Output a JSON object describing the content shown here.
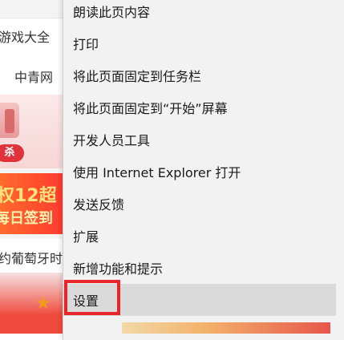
{
  "background_page": {
    "games_link": "游戏大全",
    "news_link": "中青网",
    "promo_badge": "杀",
    "banner_line1": "权12超",
    "banner_line2": "每日签到",
    "headline": "约葡萄牙时"
  },
  "context_menu": {
    "items": [
      {
        "label": "朗读此页内容"
      },
      {
        "label": "打印"
      },
      {
        "label": "将此页面固定到任务栏"
      },
      {
        "label": "将此页面固定到“开始”屏幕"
      },
      {
        "label": "开发人员工具"
      },
      {
        "label": "使用 Internet Explorer 打开"
      },
      {
        "label": "发送反馈"
      },
      {
        "label": "扩展"
      },
      {
        "label": "新增功能和提示"
      },
      {
        "label": "设置"
      }
    ],
    "selected_index": 9
  },
  "colors": {
    "menu_background": "#f2f2f2",
    "selected_background": "#dadada",
    "highlight_border": "#e8252a"
  }
}
